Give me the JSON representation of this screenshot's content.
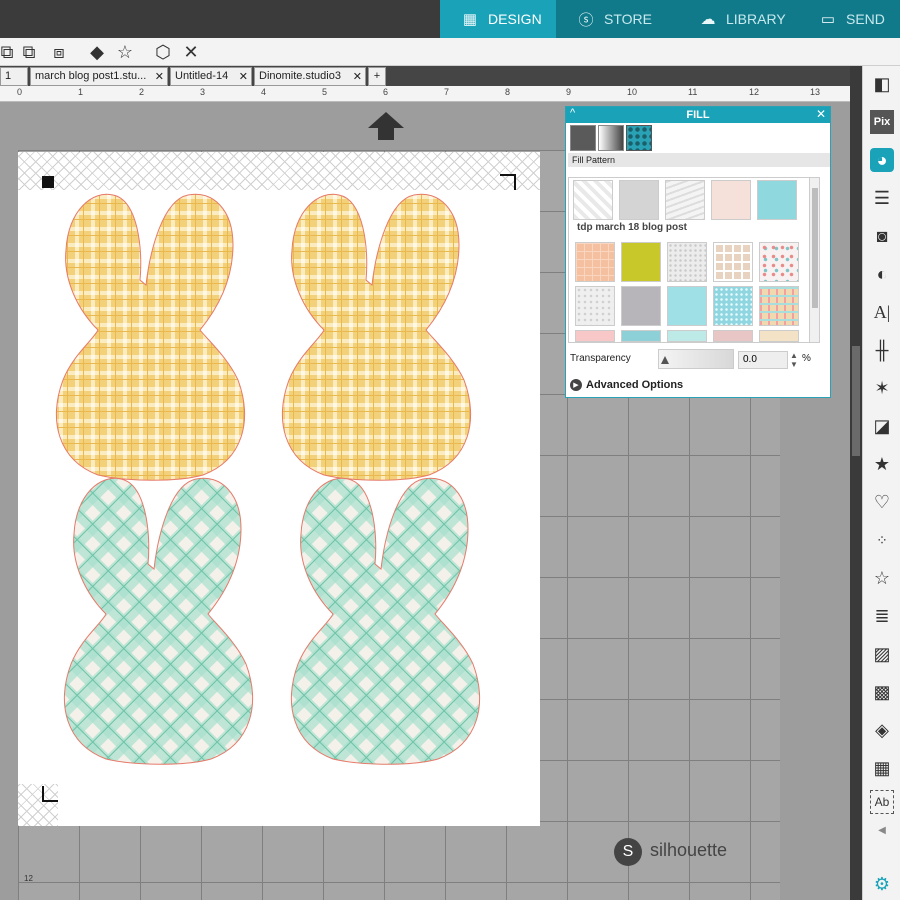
{
  "nav": {
    "design": "DESIGN",
    "store": "STORE",
    "library": "LIBRARY",
    "send": "SEND"
  },
  "doctabs": [
    {
      "label": "1"
    },
    {
      "label": "march blog post1.stu..."
    },
    {
      "label": "Untitled-14"
    },
    {
      "label": "Dinomite.studio3"
    },
    {
      "label": "+"
    }
  ],
  "ruler": [
    "0",
    "1",
    "2",
    "3",
    "4",
    "5",
    "6",
    "7",
    "8",
    "9",
    "10",
    "11",
    "12",
    "13"
  ],
  "ruler_left_label": "12",
  "fill_panel": {
    "title": "FILL",
    "section_label": "Fill Pattern",
    "group_label": "tdp march 18 blog post",
    "transparency_label": "Transparency",
    "transparency_value": "0.0",
    "percent": "%",
    "advanced": "Advanced Options"
  },
  "brand": "silhouette",
  "colors": {
    "accent": "#1aa3b8",
    "yellow_plaid": "#f3c969",
    "mint_plaid": "#8fd3bf"
  }
}
